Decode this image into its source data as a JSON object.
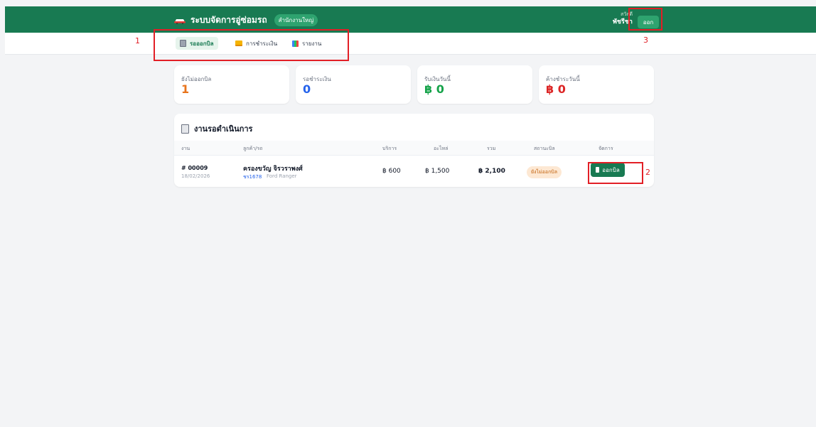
{
  "header": {
    "title": "ระบบจัดการอู่ซ่อมรถ",
    "branch": "สำนักงานใหญ่",
    "greeting": "สวัสดี",
    "user_name": "พัชรีชา",
    "logout_label": "ออก"
  },
  "tabs": [
    {
      "label": "รอออกบิล",
      "icon": "clipboard-icon",
      "active": true
    },
    {
      "label": "การชำระเงิน",
      "icon": "card-icon",
      "active": false
    },
    {
      "label": "รายงาน",
      "icon": "chart-icon",
      "active": false
    }
  ],
  "stats": [
    {
      "label": "ยังไม่ออกบิล",
      "value": "1",
      "color": "#e8741c"
    },
    {
      "label": "รอชำระเงิน",
      "value": "0",
      "color": "#2563eb"
    },
    {
      "label": "รับเงินวันนี้",
      "value": "฿ 0",
      "color": "#16a34a"
    },
    {
      "label": "ค้างชำระวันนี้",
      "value": "฿ 0",
      "color": "#dc2626"
    }
  ],
  "jobs_panel": {
    "title": "งานรอดำเนินการ",
    "columns": [
      "งาน",
      "ลูกค้า/รถ",
      "บริการ",
      "อะไหล่",
      "รวม",
      "สถานะบิล",
      "จัดการ"
    ],
    "rows": [
      {
        "job_no": "# 00009",
        "date": "18/02/2026",
        "customer": "ครองขวัญ จิรวราพงศ์",
        "plate": "ชร1678",
        "car_model": "Ford Ranger",
        "service": "฿ 600",
        "parts": "฿ 1,500",
        "total": "฿ 2,100",
        "status": "ยังไม่ออกบิล",
        "action_label": "ออกบิล"
      }
    ]
  },
  "annotations": [
    "1",
    "2",
    "3"
  ],
  "colors": {
    "primary": "#187a52",
    "annotation": "#e21f26"
  }
}
